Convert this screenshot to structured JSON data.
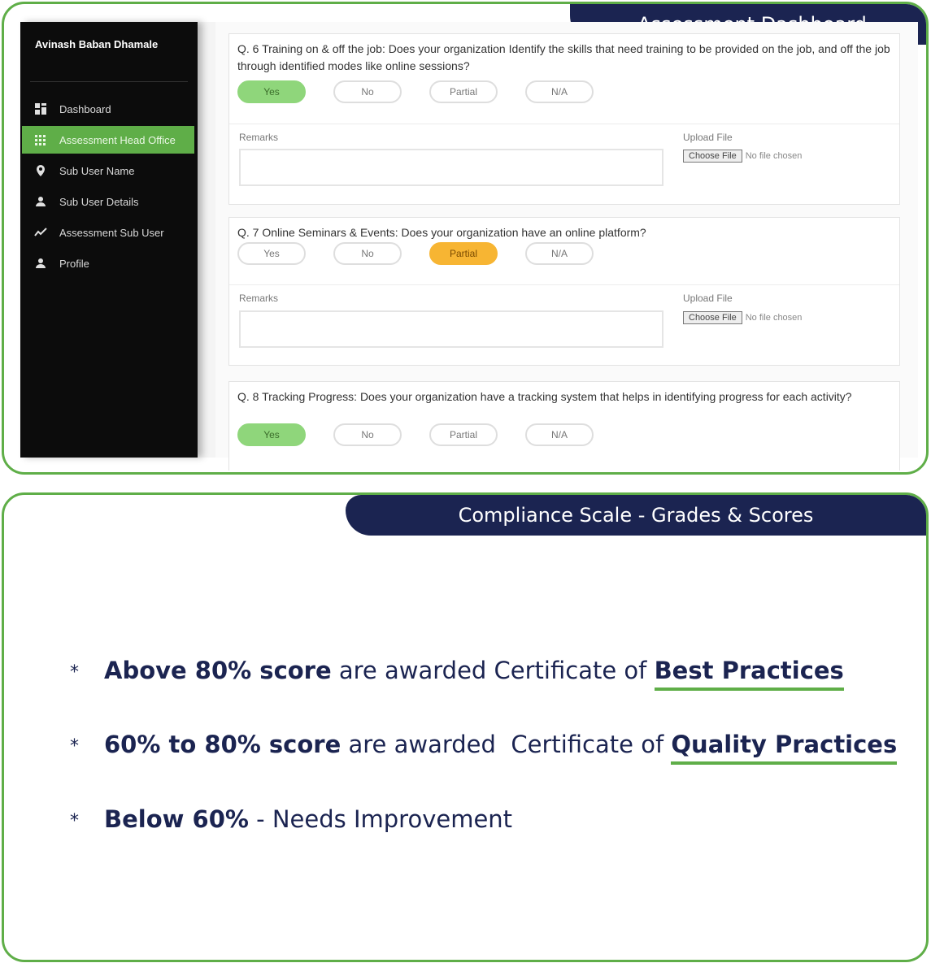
{
  "top_panel": {
    "title": "Assessment Dashboard"
  },
  "sidebar": {
    "user_name": "Avinash Baban Dhamale",
    "items": [
      {
        "label": "Dashboard",
        "icon": "dashboard-icon"
      },
      {
        "label": "Assessment Head Office",
        "icon": "grid-icon",
        "active": true
      },
      {
        "label": "Sub User Name",
        "icon": "location-pin-icon"
      },
      {
        "label": "Sub User Details",
        "icon": "user-icon"
      },
      {
        "label": "Assessment Sub User",
        "icon": "trend-line-icon"
      },
      {
        "label": "Profile",
        "icon": "user-icon"
      }
    ]
  },
  "questions": [
    {
      "text": "Q. 6 Training on & off the job: Does your organization Identify the skills that need training to be provided on the job, and off the job through identified modes like online sessions?",
      "options": [
        "Yes",
        "No",
        "Partial",
        "N/A"
      ],
      "selected": "Yes",
      "remarks_label": "Remarks",
      "upload_label": "Upload File",
      "file_button": "Choose File",
      "file_status": "No file chosen"
    },
    {
      "text": "Q. 7 Online Seminars & Events: Does your organization have an online platform?",
      "options": [
        "Yes",
        "No",
        "Partial",
        "N/A"
      ],
      "selected": "Partial",
      "remarks_label": "Remarks",
      "upload_label": "Upload File",
      "file_button": "Choose File",
      "file_status": "No file chosen"
    },
    {
      "text": "Q. 8 Tracking Progress: Does your organization have a tracking system that helps in identifying progress for each activity?",
      "options": [
        "Yes",
        "No",
        "Partial",
        "N/A"
      ],
      "selected": "Yes"
    }
  ],
  "bottom_panel": {
    "title": "Compliance Scale - Grades & Scores",
    "bullet": "*",
    "criteria": [
      {
        "lead": "Above 80% score",
        "middle": " are awarded Certificate of ",
        "emphasis": "Best Practices"
      },
      {
        "lead": "60% to 80% score",
        "middle": " are awarded  Certificate of ",
        "emphasis": "Quality Practices"
      },
      {
        "lead": "Below 60%",
        "middle": " - Needs Improvement",
        "emphasis": ""
      }
    ]
  },
  "colors": {
    "navy": "#1b2451",
    "green": "#5fae48",
    "selected_green": "#8fd67b",
    "selected_orange": "#f7b533"
  }
}
